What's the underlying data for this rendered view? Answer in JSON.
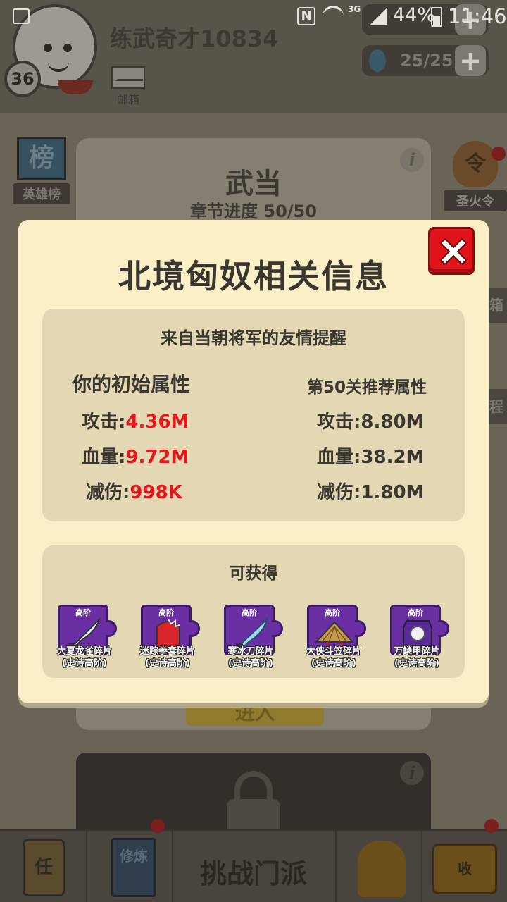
{
  "status_bar": {
    "network": "3G",
    "battery": "44%",
    "time": "11:46"
  },
  "player": {
    "name": "练武奇才10834",
    "level": "36",
    "mail_label": "邮箱",
    "energy": "25/25"
  },
  "background": {
    "left_badge": "英雄榜",
    "left_badge_icon": "榜",
    "right_badge_icon": "令",
    "right_badge": "圣火令",
    "right_edge_1": "箱",
    "right_edge_2": "程",
    "panel_title": "武当",
    "panel_sub": "章节进度 50/50",
    "enter_label": "进入"
  },
  "bottom_nav": {
    "quest_icon": "任",
    "cultivate_icon": "修炼",
    "main_label": "挑战门派",
    "collect_icon": "收"
  },
  "dialog": {
    "title": "北境匈奴相关信息",
    "tip_heading": "来自当朝将军的友情提醒",
    "your_stats_heading": "你的初始属性",
    "recommended_heading": "第50关推荐属性",
    "your_stats": [
      {
        "label": "攻击:",
        "value": "4.36M"
      },
      {
        "label": "血量:",
        "value": "9.72M"
      },
      {
        "label": "减伤:",
        "value": "998K"
      }
    ],
    "recommended_stats": [
      {
        "label": "攻击:",
        "value": "8.80M"
      },
      {
        "label": "血量:",
        "value": "38.2M"
      },
      {
        "label": "减伤:",
        "value": "1.80M"
      }
    ],
    "rewards_heading": "可获得",
    "rewards": [
      {
        "tier": "高阶",
        "name": "大夏龙雀碎片",
        "rarity": "(史诗高阶)",
        "icon": "saber-icon"
      },
      {
        "tier": "高阶",
        "name": "迷踪拳套碎片",
        "rarity": "(史诗高阶)",
        "icon": "gauntlet-icon"
      },
      {
        "tier": "高阶",
        "name": "寒冰刀碎片",
        "rarity": "(史诗高阶)",
        "icon": "ice-blade-icon"
      },
      {
        "tier": "高阶",
        "name": "大侠斗笠碎片",
        "rarity": "(史诗高阶)",
        "icon": "straw-hat-icon"
      },
      {
        "tier": "高阶",
        "name": "万鳞甲碎片",
        "rarity": "(史诗高阶)",
        "icon": "scale-armor-icon"
      }
    ]
  },
  "colors": {
    "dialog_bg": "#fbefc7",
    "box_bg": "#e4d7b3",
    "player_value": "#e8141a",
    "close_red": "#e0141a",
    "reward_purple": "#6a2fa3"
  }
}
